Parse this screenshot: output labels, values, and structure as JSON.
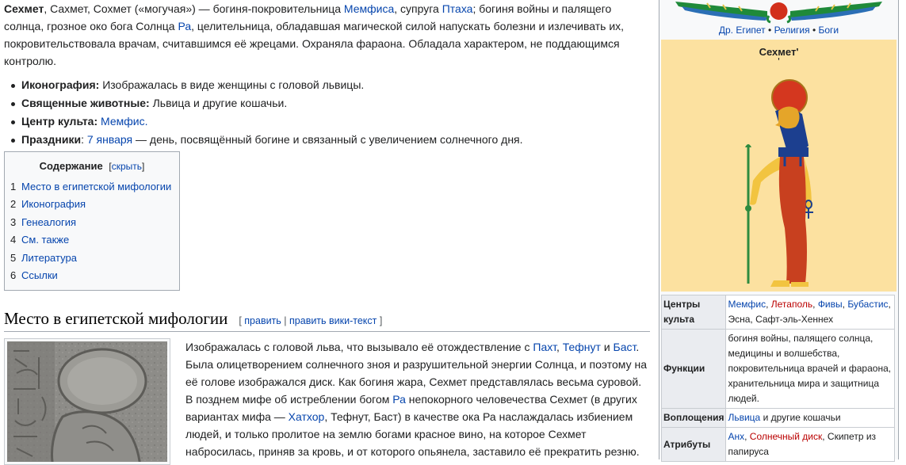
{
  "intro": {
    "name_bold": "Сехмет",
    "t1": ", Сахмет, Сохмет («могучая») — богиня-покровительница ",
    "link_memphis": "Мемфиса",
    "t2": ", супруга ",
    "link_ptah": "Птаха",
    "t3": "; богиня войны и палящего солнца, грозное око бога Солнца ",
    "link_ra": "Ра",
    "t4": ", целительница, обладавшая магической силой напускать болезни и излечивать их, покровительствовала врачам, считавшимся её жрецами. Охраняла фараона. Обладала характером, не поддающимся контролю."
  },
  "facts": {
    "iconography_label": "Иконография:",
    "iconography_text": " Изображалась в виде женщины с головой львицы.",
    "animals_label": "Священные животные:",
    "animals_text": " Львица и другие кошачьи.",
    "cult_label": "Центр культа:",
    "cult_link": "Мемфис.",
    "holidays_label": "Праздники",
    "holidays_colon": ": ",
    "holidays_link": "7 января",
    "holidays_text": " — день, посвящённый богине и связанный с увеличением солнечного дня."
  },
  "toc": {
    "title": "Содержание",
    "hide_open": "[",
    "hide_label": "скрыть",
    "hide_close": "]",
    "items": [
      {
        "num": "1",
        "label": "Место в египетской мифологии"
      },
      {
        "num": "2",
        "label": "Иконография"
      },
      {
        "num": "3",
        "label": "Генеалогия"
      },
      {
        "num": "4",
        "label": "См. также"
      },
      {
        "num": "5",
        "label": "Литература"
      },
      {
        "num": "6",
        "label": "Ссылки"
      }
    ]
  },
  "section": {
    "heading": "Место в египетской мифологии",
    "edit_open": "[ ",
    "edit_label": "править",
    "edit_sep": " | ",
    "edit_source_label": "править вики-текст",
    "edit_close": " ]"
  },
  "body": {
    "p1": "Изображалась с головой льва, что вызывало её отождествление с ",
    "l_paht": "Пахт",
    "p2": ", ",
    "l_tefnut": "Тефнут",
    "p3": " и ",
    "l_bast": "Баст",
    "p4": ". Была олицетворением солнечного зноя и разрушительной энергии Солнца, и поэтому на её голове изображался диск. Как богиня жара, Сехмет представлялась весьма суровой. В позднем мифе об истреблении богом ",
    "l_ra": "Ра",
    "p5": " непокорного человечества Сехмет (в других вариантах мифа — ",
    "l_hathor": "Хатхор",
    "p6": ", Тефнут, Баст) в качестве ока Ра наслаждалась избиением людей, и только пролитое на землю богами красное вино, на которое Сехмет набросилась, приняв за кровь, и от которого опьянела, заставило её прекратить резню."
  },
  "infobox": {
    "crumb_egypt": "Др. Египет",
    "crumb_sep1": " • ",
    "crumb_religion": "Религия",
    "crumb_sep2": " • ",
    "crumb_gods": "Боги",
    "god_title": "Сехмет'",
    "god_subtitle": "'",
    "rows": {
      "cult_label": "Центры культа",
      "cult_memphis": "Мемфис",
      "cult_c1": ", ",
      "cult_letopolis": "Летаполь",
      "cult_c2": ", ",
      "cult_thebes": "Фивы",
      "cult_c3": ", ",
      "cult_bubastis": "Бубастис",
      "cult_rest": ", Эсна, Сафт-эль-Хеннех",
      "func_label": "Функции",
      "func_text": "богиня войны, палящего солнца, медицины и волшебства, покровительница врачей и фараона, хранительница мира и защитница людей.",
      "incarn_label": "Воплощения",
      "incarn_link": "Львица",
      "incarn_text": " и другие кошачьи",
      "attr_label": "Атрибуты",
      "attr_ankh": "Анх",
      "attr_c1": ", ",
      "attr_disk": "Солнечный диск",
      "attr_rest": ", Скипетр из папируса"
    }
  },
  "colors": {
    "link": "#0645ad",
    "redlink": "#ba0000",
    "infobox_image_bg": "#fce1a0"
  }
}
